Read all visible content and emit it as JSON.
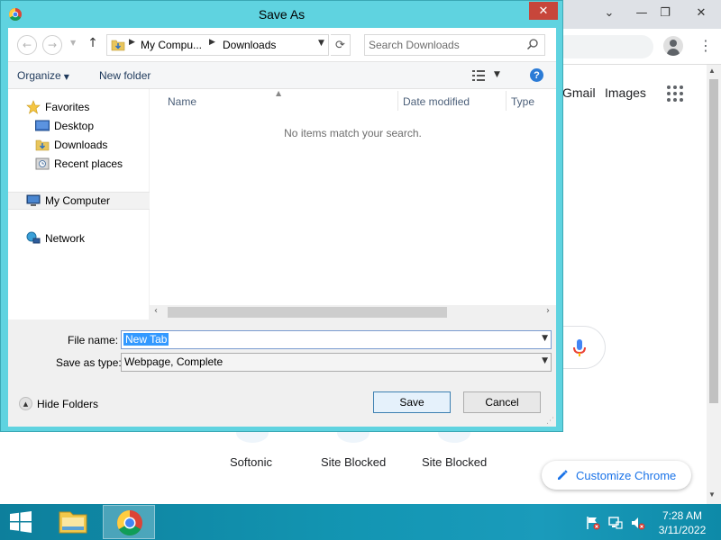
{
  "dialog": {
    "title": "Save As",
    "close_glyph": "✕",
    "breadcrumb": [
      "My Compu...",
      "Downloads"
    ],
    "search_placeholder": "Search Downloads",
    "toolbar": {
      "organize": "Organize",
      "new_folder": "New folder",
      "help_glyph": "?"
    },
    "nav": {
      "favorites_label": "Favorites",
      "favorites": [
        "Desktop",
        "Downloads",
        "Recent places"
      ],
      "my_computer": "My Computer",
      "network": "Network"
    },
    "columns": [
      "Name",
      "Date modified",
      "Type"
    ],
    "empty_message": "No items match your search.",
    "file_name_label": "File name:",
    "file_name_value": "New Tab",
    "save_type_label": "Save as type:",
    "save_type_value": "Webpage, Complete",
    "hide_folders": "Hide Folders",
    "save_button": "Save",
    "cancel_button": "Cancel"
  },
  "chrome": {
    "gmail": "Gmail",
    "images": "Images",
    "shortcuts": [
      "Softonic",
      "Site Blocked",
      "Site Blocked"
    ],
    "customize": "Customize Chrome"
  },
  "taskbar": {
    "time": "7:28 AM",
    "date": "3/11/2022"
  },
  "colors": {
    "dialog_frame": "#5fd3e0",
    "close_button": "#c7463b",
    "taskbar": "#1396b3",
    "selection": "#3399ff"
  }
}
